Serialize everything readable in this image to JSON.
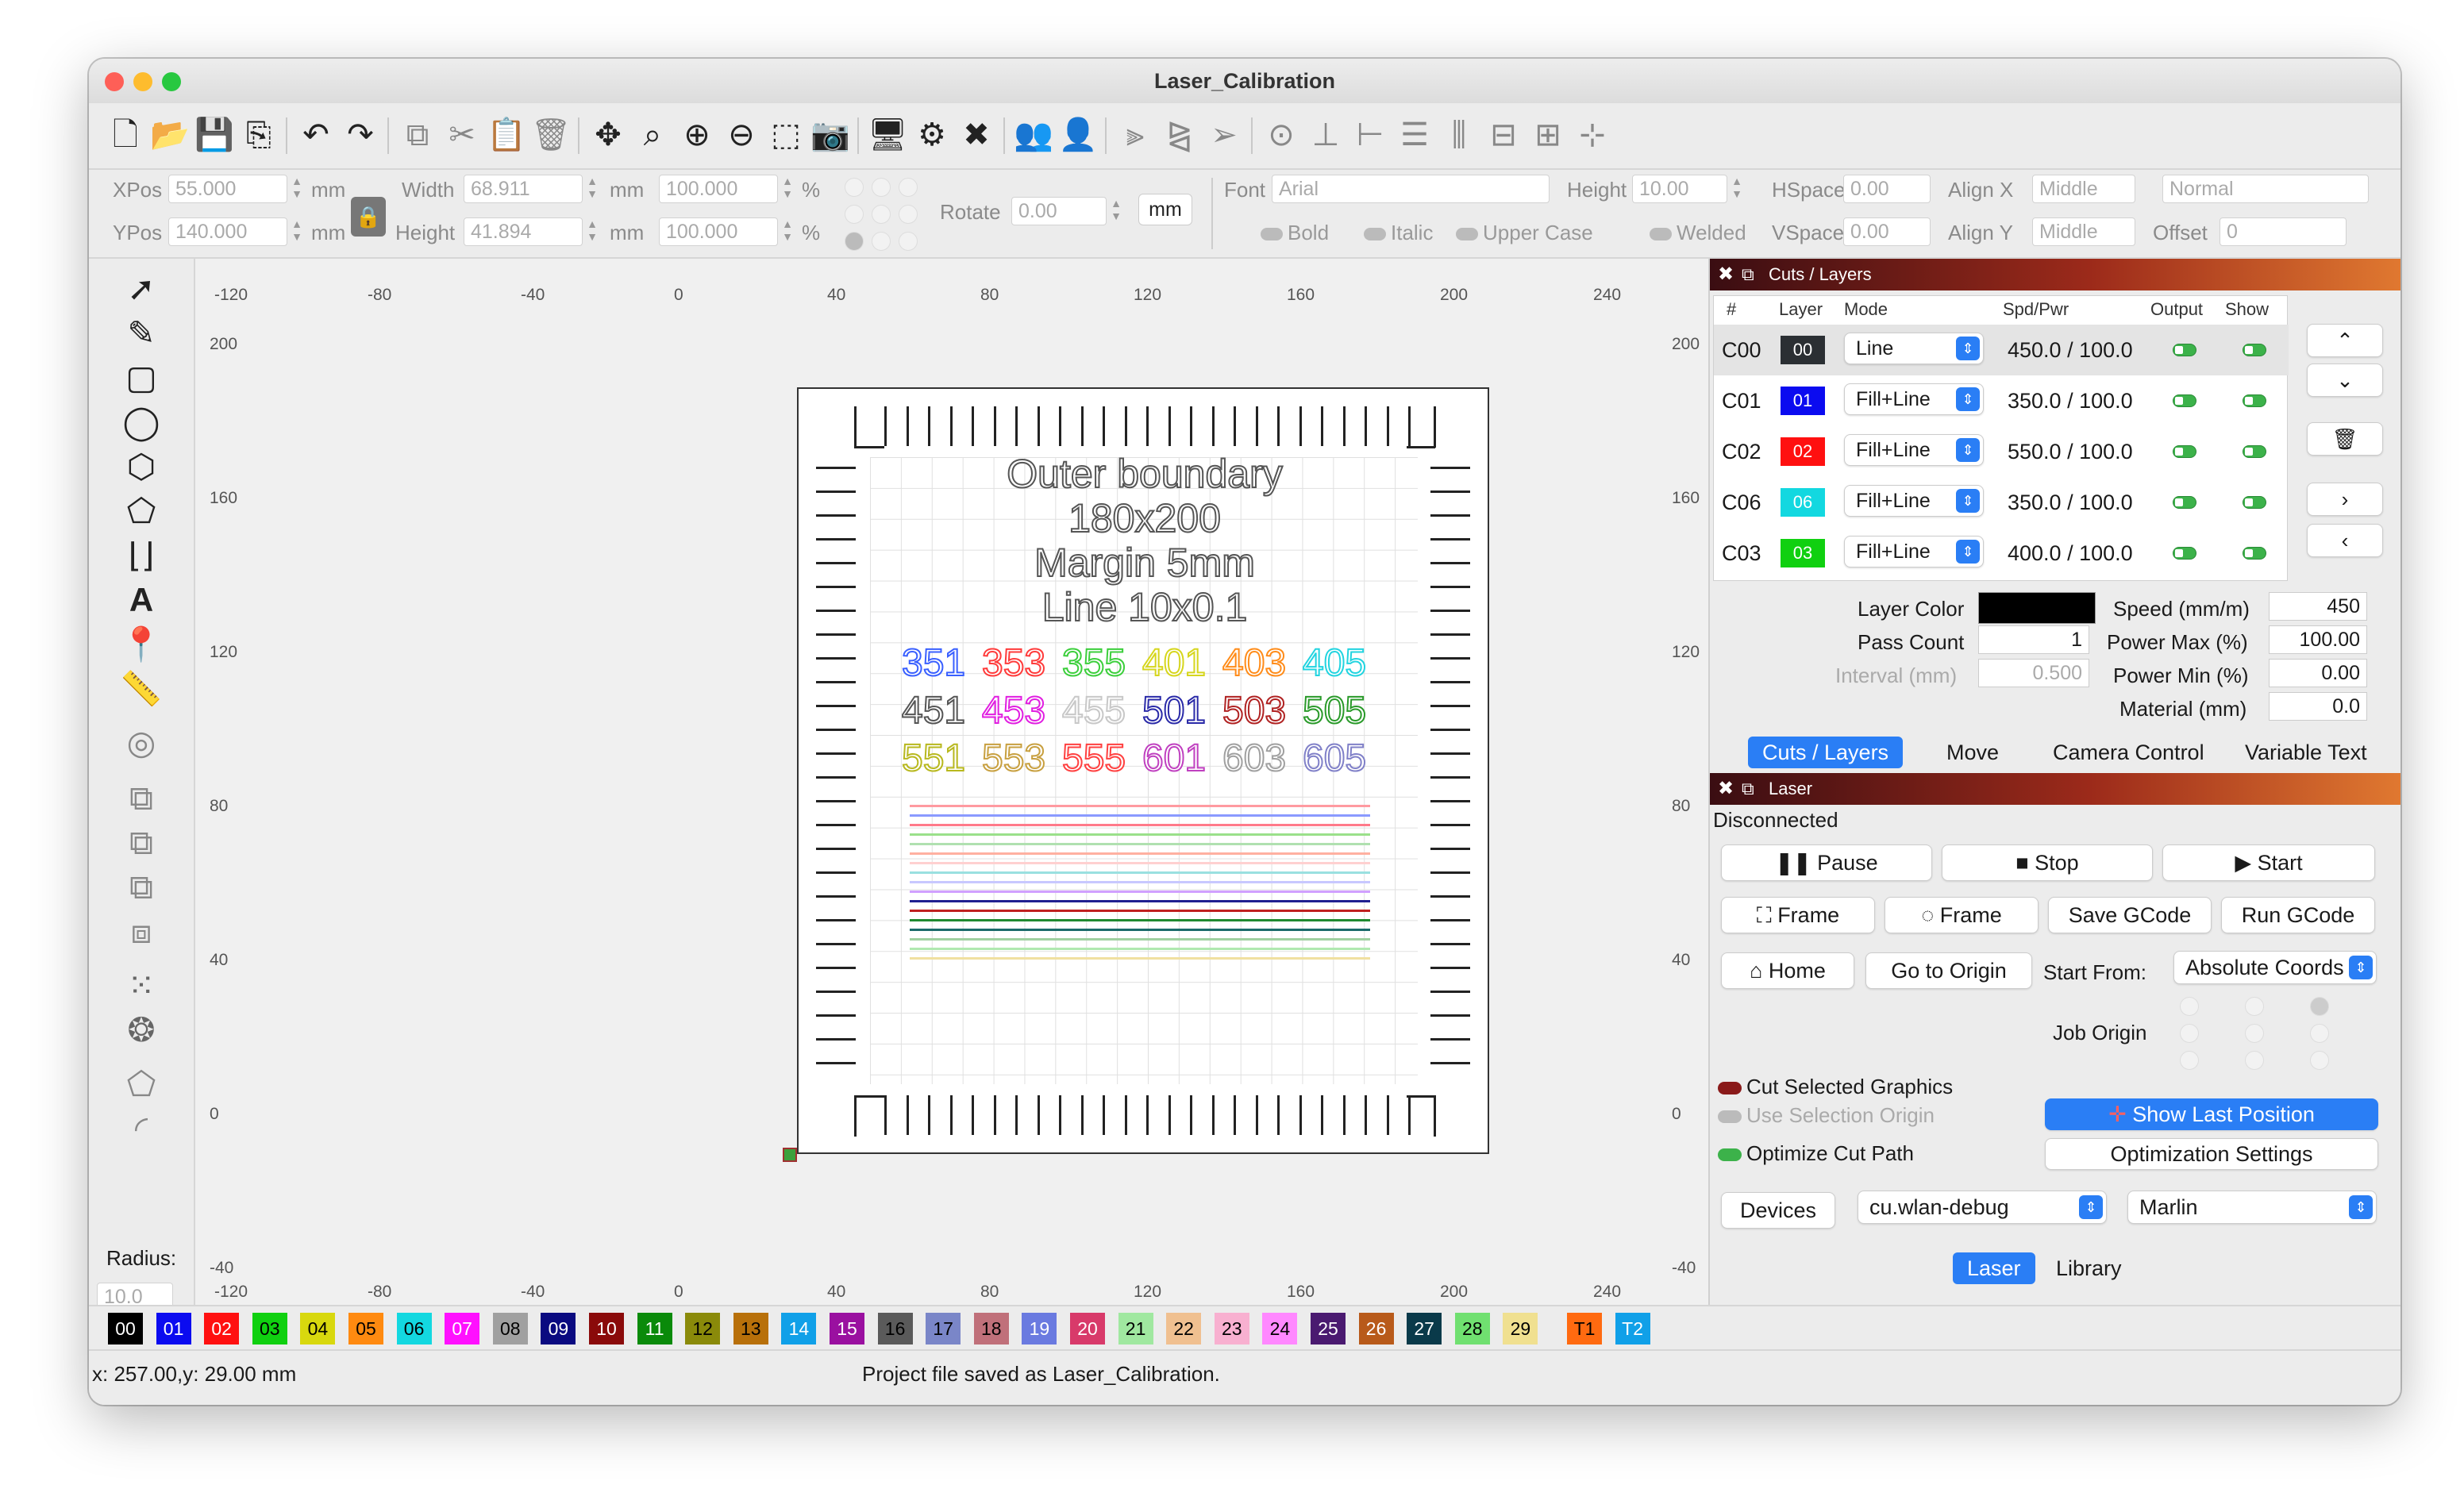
{
  "window": {
    "title": "Laser_Calibration"
  },
  "toolbar2": {
    "xpos_label": "XPos",
    "xpos_value": "55.000",
    "ypos_label": "YPos",
    "ypos_value": "140.000",
    "unit_mm": "mm",
    "width_label": "Width",
    "width_value": "68.911",
    "height_label": "Height",
    "height_value": "41.894",
    "scale_w": "100.000",
    "scale_h": "100.000",
    "percent": "%",
    "rotate_label": "Rotate",
    "rotate_value": "0.00",
    "unit_button": "mm",
    "font_label": "Font",
    "font_value": "Arial",
    "font_height_label": "Height",
    "font_height_value": "10.00",
    "hspace_label": "HSpace",
    "hspace_value": "0.00",
    "vspace_label": "VSpace",
    "vspace_value": "0.00",
    "alignx_label": "Align X",
    "alignx_value": "Middle",
    "aligny_label": "Align Y",
    "aligny_value": "Middle",
    "style_value": "Normal",
    "offset_label": "Offset",
    "offset_value": "0",
    "bold": "Bold",
    "italic": "Italic",
    "upper": "Upper Case",
    "welded": "Welded"
  },
  "lefttools": {
    "radius_label": "Radius:",
    "radius_value": "10.0"
  },
  "rulers": {
    "top": [
      "-120",
      "-80",
      "-40",
      "0",
      "40",
      "80",
      "120",
      "160",
      "200",
      "240"
    ],
    "left": [
      "200",
      "160",
      "120",
      "80",
      "40",
      "0",
      "-40"
    ]
  },
  "canvas_text": {
    "line1": "Outer boundary",
    "line2": "180x200",
    "line3": "Margin 5mm",
    "line4": "Line 10x0.1",
    "row1": [
      {
        "t": "351",
        "c": "#3a60ff"
      },
      {
        "t": "353",
        "c": "#ff3b3b"
      },
      {
        "t": "355",
        "c": "#3ccf3c"
      },
      {
        "t": "401",
        "c": "#d6d61e"
      },
      {
        "t": "403",
        "c": "#ff8c1a"
      },
      {
        "t": "405",
        "c": "#22d4e0"
      }
    ],
    "row2": [
      {
        "t": "451",
        "c": "#555555"
      },
      {
        "t": "453",
        "c": "#e11ee1"
      },
      {
        "t": "455",
        "c": "#c8c8c8"
      },
      {
        "t": "501",
        "c": "#2a2aa8"
      },
      {
        "t": "503",
        "c": "#b02222"
      },
      {
        "t": "505",
        "c": "#2a9a2a"
      }
    ],
    "row3": [
      {
        "t": "551",
        "c": "#b8b81e"
      },
      {
        "t": "553",
        "c": "#c8a040"
      },
      {
        "t": "555",
        "c": "#ff4040"
      },
      {
        "t": "601",
        "c": "#c040c0"
      },
      {
        "t": "603",
        "c": "#a0a0a0"
      },
      {
        "t": "605",
        "c": "#8080c8"
      }
    ]
  },
  "cuts_panel": {
    "title": "Cuts / Layers",
    "headers": {
      "num": "#",
      "layer": "Layer",
      "mode": "Mode",
      "spdpwr": "Spd/Pwr",
      "output": "Output",
      "show": "Show"
    },
    "rows": [
      {
        "id": "C00",
        "layer": "00",
        "color": "#2b2f33",
        "mode": "Line",
        "spdpwr": "450.0 / 100.0"
      },
      {
        "id": "C01",
        "layer": "01",
        "color": "#0b0bf0",
        "mode": "Fill+Line",
        "spdpwr": "350.0 / 100.0"
      },
      {
        "id": "C02",
        "layer": "02",
        "color": "#ff1010",
        "mode": "Fill+Line",
        "spdpwr": "550.0 / 100.0"
      },
      {
        "id": "C06",
        "layer": "06",
        "color": "#13d8e0",
        "mode": "Fill+Line",
        "spdpwr": "350.0 / 100.0"
      },
      {
        "id": "C03",
        "layer": "03",
        "color": "#10d010",
        "mode": "Fill+Line",
        "spdpwr": "400.0 / 100.0"
      }
    ],
    "layer_color_label": "Layer Color",
    "layer_color": "#000000",
    "pass_count_label": "Pass Count",
    "pass_count": "1",
    "interval_label": "Interval (mm)",
    "interval": "0.500",
    "speed_label": "Speed (mm/m)",
    "speed": "450",
    "power_max_label": "Power Max (%)",
    "power_max": "100.00",
    "power_min_label": "Power Min (%)",
    "power_min": "0.00",
    "material_label": "Material (mm)",
    "material": "0.0",
    "tabs": [
      "Cuts / Layers",
      "Move",
      "Camera Control",
      "Variable Text"
    ]
  },
  "laser_panel": {
    "title": "Laser",
    "status": "Disconnected",
    "pause": "Pause",
    "stop": "Stop",
    "start": "Start",
    "frame1": "Frame",
    "frame2": "Frame",
    "save_gcode": "Save GCode",
    "run_gcode": "Run GCode",
    "home": "Home",
    "go_origin": "Go to Origin",
    "start_from_label": "Start From:",
    "start_from": "Absolute Coords",
    "job_origin": "Job Origin",
    "cut_selected": "Cut Selected Graphics",
    "use_sel_origin": "Use Selection Origin",
    "optimize": "Optimize Cut Path",
    "show_last": "Show Last Position",
    "opt_settings": "Optimization Settings",
    "devices": "Devices",
    "port": "cu.wlan-debug",
    "firmware": "Marlin",
    "tabs": [
      "Laser",
      "Library"
    ]
  },
  "palette": [
    {
      "t": "00",
      "c": "#000000",
      "f": "#fff"
    },
    {
      "t": "01",
      "c": "#0b0bf0",
      "f": "#fff"
    },
    {
      "t": "02",
      "c": "#ff1010",
      "f": "#fff"
    },
    {
      "t": "03",
      "c": "#10d010",
      "f": "#000"
    },
    {
      "t": "04",
      "c": "#d8d80e",
      "f": "#000"
    },
    {
      "t": "05",
      "c": "#ff8a10",
      "f": "#000"
    },
    {
      "t": "06",
      "c": "#13d8e0",
      "f": "#000"
    },
    {
      "t": "07",
      "c": "#ff10ff",
      "f": "#fff"
    },
    {
      "t": "08",
      "c": "#a0a0a0",
      "f": "#000"
    },
    {
      "t": "09",
      "c": "#0a0a80",
      "f": "#fff"
    },
    {
      "t": "10",
      "c": "#8a0a0a",
      "f": "#fff"
    },
    {
      "t": "11",
      "c": "#0a8a0a",
      "f": "#fff"
    },
    {
      "t": "12",
      "c": "#8a8a0a",
      "f": "#000"
    },
    {
      "t": "13",
      "c": "#b8700a",
      "f": "#000"
    },
    {
      "t": "14",
      "c": "#10a0e8",
      "f": "#fff"
    },
    {
      "t": "15",
      "c": "#9a10a0",
      "f": "#fff"
    },
    {
      "t": "16",
      "c": "#5a5a5a",
      "f": "#000"
    },
    {
      "t": "17",
      "c": "#7a86c8",
      "f": "#000"
    },
    {
      "t": "18",
      "c": "#c0707a",
      "f": "#000"
    },
    {
      "t": "19",
      "c": "#6a7ae0",
      "f": "#fff"
    },
    {
      "t": "20",
      "c": "#d83a6a",
      "f": "#fff"
    },
    {
      "t": "21",
      "c": "#a0e8a0",
      "f": "#000"
    },
    {
      "t": "22",
      "c": "#f0c090",
      "f": "#000"
    },
    {
      "t": "23",
      "c": "#f8b0d0",
      "f": "#000"
    },
    {
      "t": "24",
      "c": "#ff88ff",
      "f": "#000"
    },
    {
      "t": "25",
      "c": "#4a1a70",
      "f": "#fff"
    },
    {
      "t": "26",
      "c": "#b85a1a",
      "f": "#fff"
    },
    {
      "t": "27",
      "c": "#0a3a4a",
      "f": "#fff"
    },
    {
      "t": "28",
      "c": "#70e070",
      "f": "#000"
    },
    {
      "t": "29",
      "c": "#f0e090",
      "f": "#000"
    },
    {
      "t": "T1",
      "c": "#ff6a10",
      "f": "#000"
    },
    {
      "t": "T2",
      "c": "#10a0e8",
      "f": "#fff"
    }
  ],
  "status": {
    "coords": "x: 257.00,y: 29.00 mm",
    "message": "Project file saved as Laser_Calibration."
  }
}
